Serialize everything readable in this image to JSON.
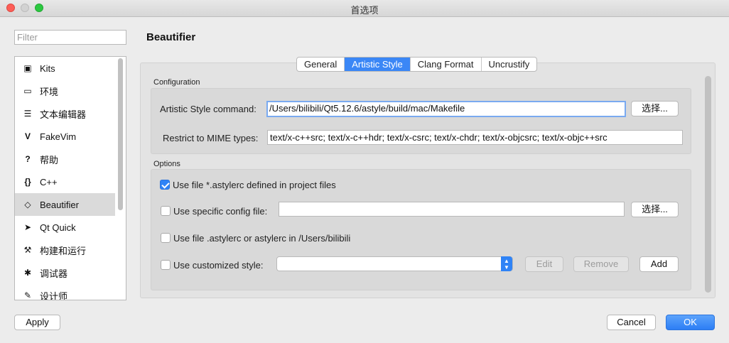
{
  "window": {
    "title": "首选项"
  },
  "filter": {
    "placeholder": "Filter"
  },
  "sidebar": {
    "items": [
      {
        "label": "Kits",
        "icon": "kits-icon",
        "glyph": "▣"
      },
      {
        "label": "环境",
        "icon": "monitor-icon",
        "glyph": "▭"
      },
      {
        "label": "文本编辑器",
        "icon": "text-editor-icon",
        "glyph": "☰"
      },
      {
        "label": "FakeVim",
        "icon": "fakevim-icon",
        "glyph": "V"
      },
      {
        "label": "帮助",
        "icon": "help-icon",
        "glyph": "?"
      },
      {
        "label": "C++",
        "icon": "cpp-braces-icon",
        "glyph": "{}"
      },
      {
        "label": "Beautifier",
        "icon": "diamond-icon",
        "glyph": "◇"
      },
      {
        "label": "Qt Quick",
        "icon": "qt-quick-icon",
        "glyph": "➤"
      },
      {
        "label": "构建和运行",
        "icon": "hammer-icon",
        "glyph": "⚒"
      },
      {
        "label": "调试器",
        "icon": "bug-icon",
        "glyph": "✱"
      },
      {
        "label": "设计师",
        "icon": "pencil-icon",
        "glyph": "✎"
      }
    ],
    "selected": "Beautifier"
  },
  "page": {
    "title": "Beautifier"
  },
  "tabs": [
    {
      "label": "General"
    },
    {
      "label": "Artistic Style",
      "active": true
    },
    {
      "label": "Clang Format"
    },
    {
      "label": "Uncrustify"
    }
  ],
  "configuration": {
    "group_label": "Configuration",
    "command_label": "Artistic Style command:",
    "command_value": "/Users/bilibili/Qt5.12.6/astyle/build/mac/Makefile",
    "browse_label": "选择...",
    "mime_label": "Restrict to MIME types:",
    "mime_value": "text/x-c++src; text/x-c++hdr; text/x-csrc; text/x-chdr; text/x-objcsrc; text/x-objc++src"
  },
  "options": {
    "group_label": "Options",
    "use_project_file": {
      "label": "Use file *.astylerc defined in project files",
      "checked": true
    },
    "use_specific_config": {
      "label": "Use specific config file:",
      "checked": false,
      "value": "",
      "browse_label": "选择..."
    },
    "use_home_file": {
      "label": "Use file .astylerc or astylerc in /Users/bilibili",
      "checked": false
    },
    "use_custom_style": {
      "label": "Use customized style:",
      "checked": false,
      "selected": ""
    },
    "edit_label": "Edit",
    "remove_label": "Remove",
    "add_label": "Add"
  },
  "footer": {
    "apply_label": "Apply",
    "cancel_label": "Cancel",
    "ok_label": "OK"
  },
  "colors": {
    "accent": "#3b87f6",
    "selection": "#dadada"
  }
}
